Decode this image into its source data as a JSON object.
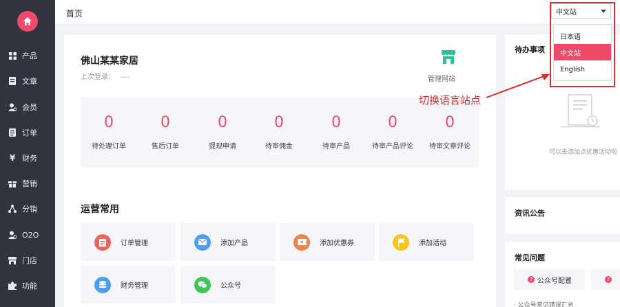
{
  "sidebar": {
    "items": [
      {
        "label": "产品",
        "icon": "grid-icon"
      },
      {
        "label": "文章",
        "icon": "document-icon"
      },
      {
        "label": "会员",
        "icon": "user-icon"
      },
      {
        "label": "订单",
        "icon": "list-icon"
      },
      {
        "label": "财务",
        "icon": "yen-icon"
      },
      {
        "label": "营销",
        "icon": "gift-icon"
      },
      {
        "label": "分销",
        "icon": "share-icon"
      },
      {
        "label": "O2O",
        "icon": "user-pin-icon"
      },
      {
        "label": "门店",
        "icon": "store-icon"
      },
      {
        "label": "功能",
        "icon": "puzzle-icon"
      }
    ]
  },
  "header": {
    "breadcrumb": "首页"
  },
  "language": {
    "selected": "中文站",
    "options": [
      {
        "label": "日本语"
      },
      {
        "label": "中文站"
      },
      {
        "label": "English"
      }
    ]
  },
  "annotation": "切换语言站点",
  "shop": {
    "name": "佛山某某家居",
    "last_login_label": "上次登录：",
    "last_login_value": "----",
    "manage_site": "管理网站"
  },
  "stats": [
    {
      "value": "0",
      "label": "待处理订单"
    },
    {
      "value": "0",
      "label": "售后订单"
    },
    {
      "value": "0",
      "label": "提现申请"
    },
    {
      "value": "0",
      "label": "待审佣金"
    },
    {
      "value": "0",
      "label": "待审产品"
    },
    {
      "value": "0",
      "label": "待审产品评论"
    },
    {
      "value": "0",
      "label": "待审文章评论"
    }
  ],
  "operations": {
    "title": "运营常用",
    "items": [
      {
        "label": "订单管理",
        "color": "#f0645a"
      },
      {
        "label": "添加产品",
        "color": "#4b9ef5"
      },
      {
        "label": "添加优惠券",
        "color": "#f0824a"
      },
      {
        "label": "添加活动",
        "color": "#f5c518"
      },
      {
        "label": "财务管理",
        "color": "#4b9ef5"
      },
      {
        "label": "公众号",
        "color": "#3fc45a"
      }
    ]
  },
  "todo": {
    "title": "待办事项",
    "empty_text": "可以去添加点优惠活动啦"
  },
  "news": {
    "title": "资讯公告"
  },
  "faq": {
    "title": "常见问题",
    "buttons": [
      {
        "label": "公众号配置"
      },
      {
        "label": ""
      }
    ],
    "item": "· 公众号常见错误汇总"
  },
  "colors": {
    "accent": "#f04a6a",
    "sidebar": "#2f3440",
    "annotation": "#e0262f"
  }
}
